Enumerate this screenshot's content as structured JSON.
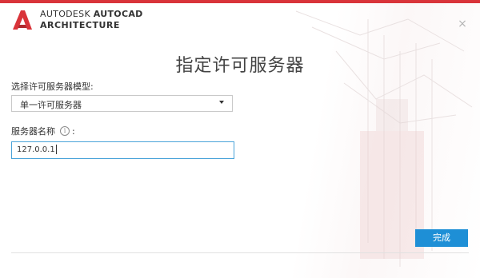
{
  "brand": {
    "line1_light": "AUTODESK",
    "line1_bold": "AUTOCAD",
    "line2": "ARCHITECTURE"
  },
  "dialog": {
    "title": "指定许可服务器",
    "model_label": "选择许可服务器模型:",
    "model_selected": "单一许可服务器",
    "server_name_label": "服务器名称",
    "server_name_suffix": ":",
    "info_glyph": "i",
    "server_name_value": "127.0.0.1",
    "finish_label": "完成",
    "close_glyph": "×"
  },
  "colors": {
    "accent": "#d9343a",
    "button": "#1e8fd6",
    "input_focus": "#4aa3d9"
  },
  "icons": {
    "logo": "autodesk-a-logo-icon",
    "close": "close-icon",
    "dropdown": "chevron-down-icon",
    "info": "info-icon"
  }
}
